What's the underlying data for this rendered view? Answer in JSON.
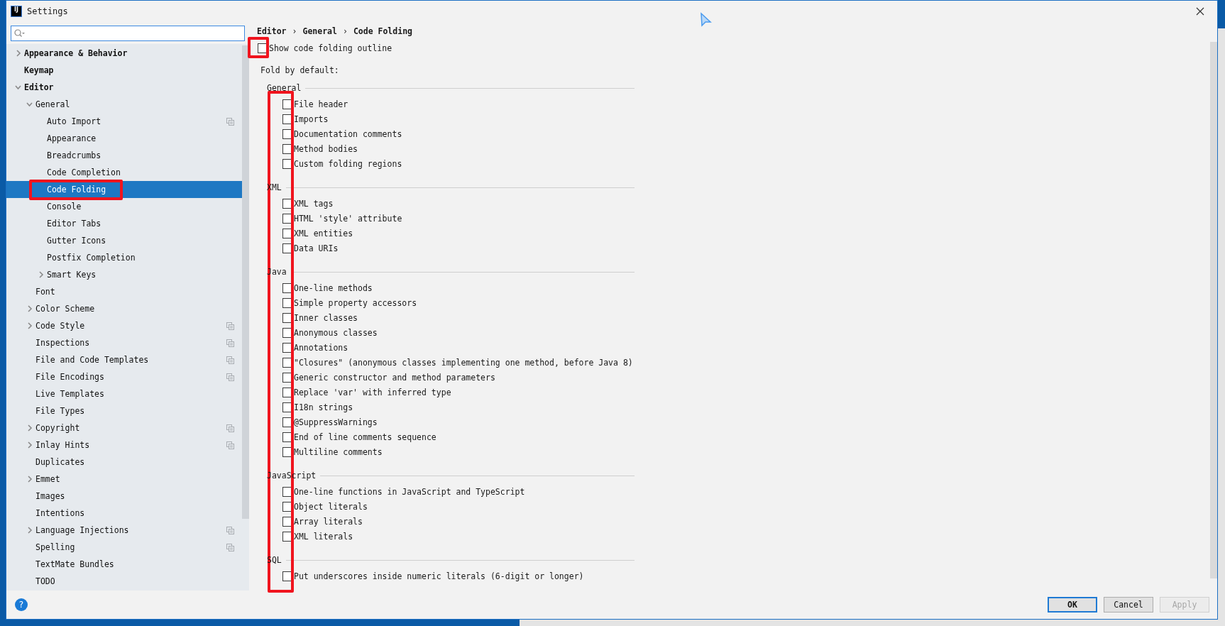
{
  "window": {
    "logo": "IJ",
    "title": "Settings"
  },
  "tree": [
    {
      "label": "Appearance & Behavior",
      "selected": false,
      "expanded": false
    },
    {
      "label": "Keymap",
      "selected": false
    },
    {
      "label": "Editor",
      "selected": false,
      "expanded": true,
      "children": [
        {
          "label": "General",
          "selected": false,
          "expanded": true,
          "children": [
            {
              "label": "Auto Import",
              "selected": false,
              "scope": true
            },
            {
              "label": "Appearance",
              "selected": false
            },
            {
              "label": "Breadcrumbs",
              "selected": false
            },
            {
              "label": "Code Completion",
              "selected": false
            },
            {
              "label": "Code Folding",
              "selected": true,
              "marked": true
            },
            {
              "label": "Console",
              "selected": false
            },
            {
              "label": "Editor Tabs",
              "selected": false
            },
            {
              "label": "Gutter Icons",
              "selected": false
            },
            {
              "label": "Postfix Completion",
              "selected": false
            },
            {
              "label": "Smart Keys",
              "selected": false,
              "expanded": false
            }
          ]
        },
        {
          "label": "Font",
          "selected": false
        },
        {
          "label": "Color Scheme",
          "selected": false,
          "expanded": false
        },
        {
          "label": "Code Style",
          "selected": false,
          "expanded": false,
          "scope": true
        },
        {
          "label": "Inspections",
          "selected": false,
          "scope": true
        },
        {
          "label": "File and Code Templates",
          "selected": false,
          "scope": true
        },
        {
          "label": "File Encodings",
          "selected": false,
          "scope": true
        },
        {
          "label": "Live Templates",
          "selected": false
        },
        {
          "label": "File Types",
          "selected": false
        },
        {
          "label": "Copyright",
          "selected": false,
          "expanded": false,
          "scope": true
        },
        {
          "label": "Inlay Hints",
          "selected": false,
          "expanded": false,
          "scope": true
        },
        {
          "label": "Duplicates",
          "selected": false
        },
        {
          "label": "Emmet",
          "selected": false,
          "expanded": false
        },
        {
          "label": "Images",
          "selected": false
        },
        {
          "label": "Intentions",
          "selected": false
        },
        {
          "label": "Language Injections",
          "selected": false,
          "expanded": false,
          "scope": true
        },
        {
          "label": "Spelling",
          "selected": false,
          "scope": true
        },
        {
          "label": "TextMate Bundles",
          "selected": false
        },
        {
          "label": "TODO",
          "selected": false
        }
      ]
    }
  ],
  "breadcrumb": {
    "items": [
      "Editor",
      "General",
      "Code Folding"
    ],
    "separator": "›"
  },
  "show_outline": {
    "label": "Show code folding outline",
    "checked": false,
    "marked": true
  },
  "fold": {
    "heading": "Fold by default:",
    "marked": true,
    "groups": [
      {
        "title": "General",
        "options": [
          {
            "label": "File header",
            "checked": false
          },
          {
            "label": "Imports",
            "checked": false
          },
          {
            "label": "Documentation comments",
            "checked": false
          },
          {
            "label": "Method bodies",
            "checked": false
          },
          {
            "label": "Custom folding regions",
            "checked": false
          }
        ]
      },
      {
        "title": "XML",
        "options": [
          {
            "label": "XML tags",
            "checked": false
          },
          {
            "label": "HTML 'style' attribute",
            "checked": false
          },
          {
            "label": "XML entities",
            "checked": false
          },
          {
            "label": "Data URIs",
            "checked": false
          }
        ]
      },
      {
        "title": "Java",
        "options": [
          {
            "label": "One-line methods",
            "checked": false
          },
          {
            "label": "Simple property accessors",
            "checked": false
          },
          {
            "label": "Inner classes",
            "checked": false
          },
          {
            "label": "Anonymous classes",
            "checked": false
          },
          {
            "label": "Annotations",
            "checked": false
          },
          {
            "label": "\"Closures\" (anonymous classes implementing one method, before Java 8)",
            "checked": false
          },
          {
            "label": "Generic constructor and method parameters",
            "checked": false
          },
          {
            "label": "Replace 'var' with inferred type",
            "checked": false
          },
          {
            "label": "I18n strings",
            "checked": false
          },
          {
            "label": "@SuppressWarnings",
            "checked": false
          },
          {
            "label": "End of line comments sequence",
            "checked": false
          },
          {
            "label": "Multiline comments",
            "checked": false
          }
        ]
      },
      {
        "title": "JavaScript",
        "options": [
          {
            "label": "One-line functions in JavaScript and TypeScript",
            "checked": false
          },
          {
            "label": "Object literals",
            "checked": false
          },
          {
            "label": "Array literals",
            "checked": false
          },
          {
            "label": "XML literals",
            "checked": false
          }
        ]
      },
      {
        "title": "SQL",
        "options": [
          {
            "label": "Put underscores inside numeric literals (6-digit or longer)",
            "checked": false
          }
        ]
      }
    ]
  },
  "help": "?",
  "buttons": [
    {
      "label": "OK",
      "kind": "default",
      "disabled": false
    },
    {
      "label": "Cancel",
      "kind": "normal",
      "disabled": false
    },
    {
      "label": "Apply",
      "kind": "normal",
      "disabled": true
    }
  ]
}
